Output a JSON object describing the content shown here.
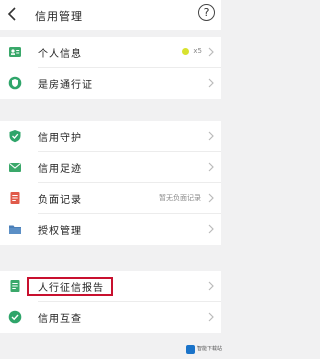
{
  "header": {
    "title": "信用管理",
    "help_glyph": "?"
  },
  "groups": [
    {
      "items": [
        {
          "label": "个人信息",
          "badge_text": "x5",
          "icon": "id-card-icon",
          "color": "#3aa86a"
        },
        {
          "label": "是房通行证",
          "icon": "shield-badge-icon",
          "color": "#2fa56a"
        }
      ]
    },
    {
      "items": [
        {
          "label": "信用守护",
          "icon": "shield-icon",
          "color": "#2fa56a"
        },
        {
          "label": "信用足迹",
          "icon": "mail-icon",
          "color": "#3aa86a"
        },
        {
          "label": "负面记录",
          "value": "暂无负面记录",
          "icon": "document-icon",
          "color": "#e05a4a"
        },
        {
          "label": "授权管理",
          "icon": "folder-icon",
          "color": "#4a7fb8"
        }
      ]
    },
    {
      "items": [
        {
          "label": "人行征信报告",
          "icon": "report-icon",
          "color": "#3aa86a"
        },
        {
          "label": "信用互查",
          "icon": "check-shield-icon",
          "color": "#2fa56a"
        }
      ]
    }
  ],
  "watermark": {
    "text": "智能下载站",
    "color": "#1a73c9"
  },
  "colors": {
    "accent": "#3aa86a",
    "highlight": "#c8102e"
  }
}
